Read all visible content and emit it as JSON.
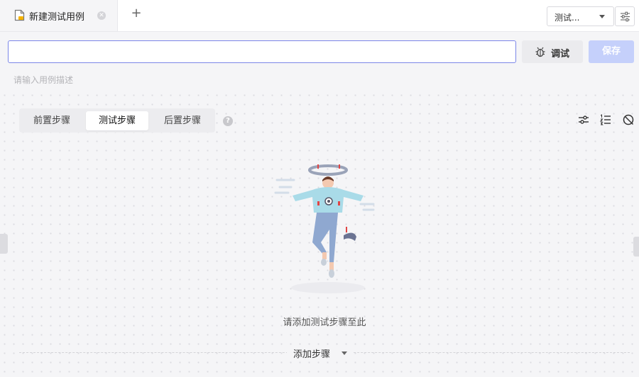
{
  "tabs": [
    {
      "label": "新建测试用例",
      "active": true,
      "icon": "file-edit-icon"
    }
  ],
  "env_select": {
    "value": "测试..."
  },
  "case_name": {
    "value": ""
  },
  "buttons": {
    "debug_label": "调试",
    "save_label": "保存"
  },
  "description": {
    "placeholder": "请输入用例描述"
  },
  "step_tabs": [
    {
      "label": "前置步骤",
      "active": false
    },
    {
      "label": "测试步骤",
      "active": true
    },
    {
      "label": "后置步骤",
      "active": false
    }
  ],
  "help_icon": {
    "glyph": "?"
  },
  "empty_state": {
    "text": "请添加测试步骤至此"
  },
  "add_step": {
    "label": "添加步骤"
  },
  "colors": {
    "accent": "#7b86e8",
    "save_disabled": "#c5d0fb"
  }
}
